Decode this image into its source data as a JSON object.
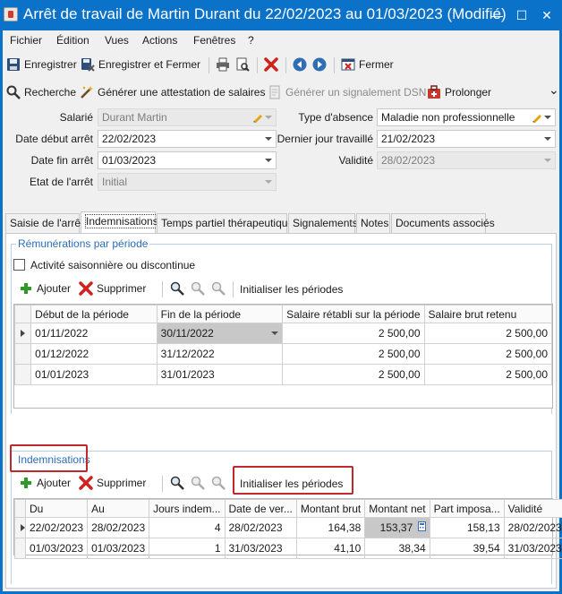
{
  "window": {
    "title": "Arrêt de travail de Martin Durant du 22/02/2023 au 01/03/2023 (Modifié)",
    "minimize": "—",
    "maximize": "☐",
    "close": "✕"
  },
  "menu": [
    "Fichier",
    "Édition",
    "Vues",
    "Actions",
    "Fenêtres",
    "?"
  ],
  "toolbar1": {
    "save": "Enregistrer",
    "save_close": "Enregistrer et Fermer",
    "close": "Fermer"
  },
  "toolbar2": {
    "search": "Recherche",
    "generate_certificate": "Générer une attestation de salaires",
    "generate_dsn": "Générer un signalement DSN",
    "extend": "Prolonger",
    "more": "⌄"
  },
  "form": {
    "salarie_label": "Salarié",
    "salarie_value": "Durant Martin",
    "type_absence_label": "Type d'absence",
    "type_absence_value": "Maladie non professionnelle",
    "date_debut_label": "Date début arrêt",
    "date_debut_value": "22/02/2023",
    "dernier_jour_label": "Dernier jour travaillé",
    "dernier_jour_value": "21/02/2023",
    "date_fin_label": "Date fin arrêt",
    "date_fin_value": "01/03/2023",
    "validite_label": "Validité",
    "validite_value": "28/02/2023",
    "etat_label": "Etat de l'arrêt",
    "etat_value": "Initial"
  },
  "tabs": [
    "Saisie de l'arrêt",
    "Indemnisations",
    "Temps partiel thérapeutique",
    "Signalements",
    "Notes",
    "Documents associés"
  ],
  "remunerations": {
    "group_title": "Rémunérations par période",
    "checkbox_label": "Activité saisonnière ou discontinue",
    "add": "Ajouter",
    "delete": "Supprimer",
    "init": "Initialiser les périodes",
    "columns": [
      "Début de la période",
      "Fin de la période",
      "Salaire rétabli sur la période",
      "Salaire brut retenu"
    ],
    "rows": [
      [
        "01/11/2022",
        "30/11/2022",
        "2 500,00",
        "2 500,00"
      ],
      [
        "01/12/2022",
        "31/12/2022",
        "2 500,00",
        "2 500,00"
      ],
      [
        "01/01/2023",
        "31/01/2023",
        "2 500,00",
        "2 500,00"
      ]
    ]
  },
  "indemnisations": {
    "group_title": "Indemnisations",
    "add": "Ajouter",
    "delete": "Supprimer",
    "init": "Initialiser les périodes",
    "columns": [
      "Du",
      "Au",
      "Jours indem...",
      "Date de ver...",
      "Montant brut",
      "Montant net",
      "Part imposa...",
      "Validité"
    ],
    "rows": [
      [
        "22/02/2023",
        "28/02/2023",
        "4",
        "28/02/2023",
        "164,38",
        "153,37",
        "158,13",
        "28/02/2023"
      ],
      [
        "01/03/2023",
        "01/03/2023",
        "1",
        "31/03/2023",
        "41,10",
        "38,34",
        "39,54",
        "31/03/2023"
      ]
    ]
  },
  "colors": {
    "titlebar": "#0b72c9",
    "accent": "#2b6cb8",
    "highlight_box": "#c0292b"
  }
}
